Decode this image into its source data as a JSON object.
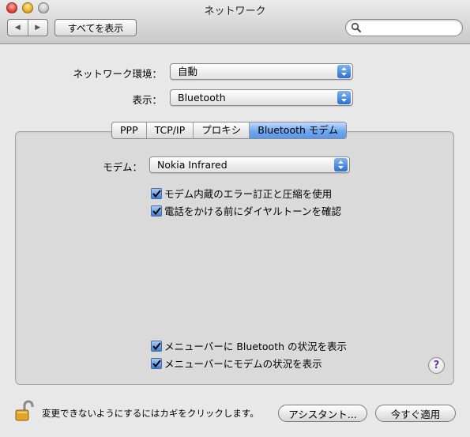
{
  "window": {
    "title": "ネットワーク"
  },
  "toolbar": {
    "show_all_label": "すべてを表示",
    "search": {
      "value": "",
      "placeholder": ""
    }
  },
  "settings": {
    "location_label": "ネットワーク環境：",
    "location_value": "自動",
    "show_label": "表示：",
    "show_value": "Bluetooth"
  },
  "tabs": [
    {
      "label": "PPP",
      "selected": false
    },
    {
      "label": "TCP/IP",
      "selected": false
    },
    {
      "label": "プロキシ",
      "selected": false
    },
    {
      "label": "Bluetooth モデム",
      "selected": true
    }
  ],
  "modem": {
    "label": "モデム：",
    "value": "Nokia Infrared"
  },
  "options": [
    {
      "label": "モデム内蔵のエラー訂正と圧縮を使用",
      "checked": true
    },
    {
      "label": "電話をかける前にダイヤルトーンを確認",
      "checked": true
    }
  ],
  "menubar_options": [
    {
      "label": "メニューバーに Bluetooth の状況を表示",
      "checked": true
    },
    {
      "label": "メニューバーにモデムの状況を表示",
      "checked": true
    }
  ],
  "footer": {
    "lock_text": "変更できないようにするにはカギをクリックします。",
    "assistant_label": "アシスタント...",
    "apply_label": "今すぐ適用"
  },
  "icons": {
    "close": "close-icon",
    "minimize": "minimize-icon",
    "zoom": "zoom-icon",
    "back": "back-icon",
    "forward": "forward-icon",
    "search": "search-icon",
    "popup": "popup-arrows-icon",
    "checkbox": "checkmark-icon",
    "help": "help-icon",
    "lock": "lock-icon"
  },
  "colors": {
    "accent": "#3d7fd9",
    "close": "#e0443a",
    "minimize": "#e8b028",
    "help": "#6a2fb8"
  }
}
